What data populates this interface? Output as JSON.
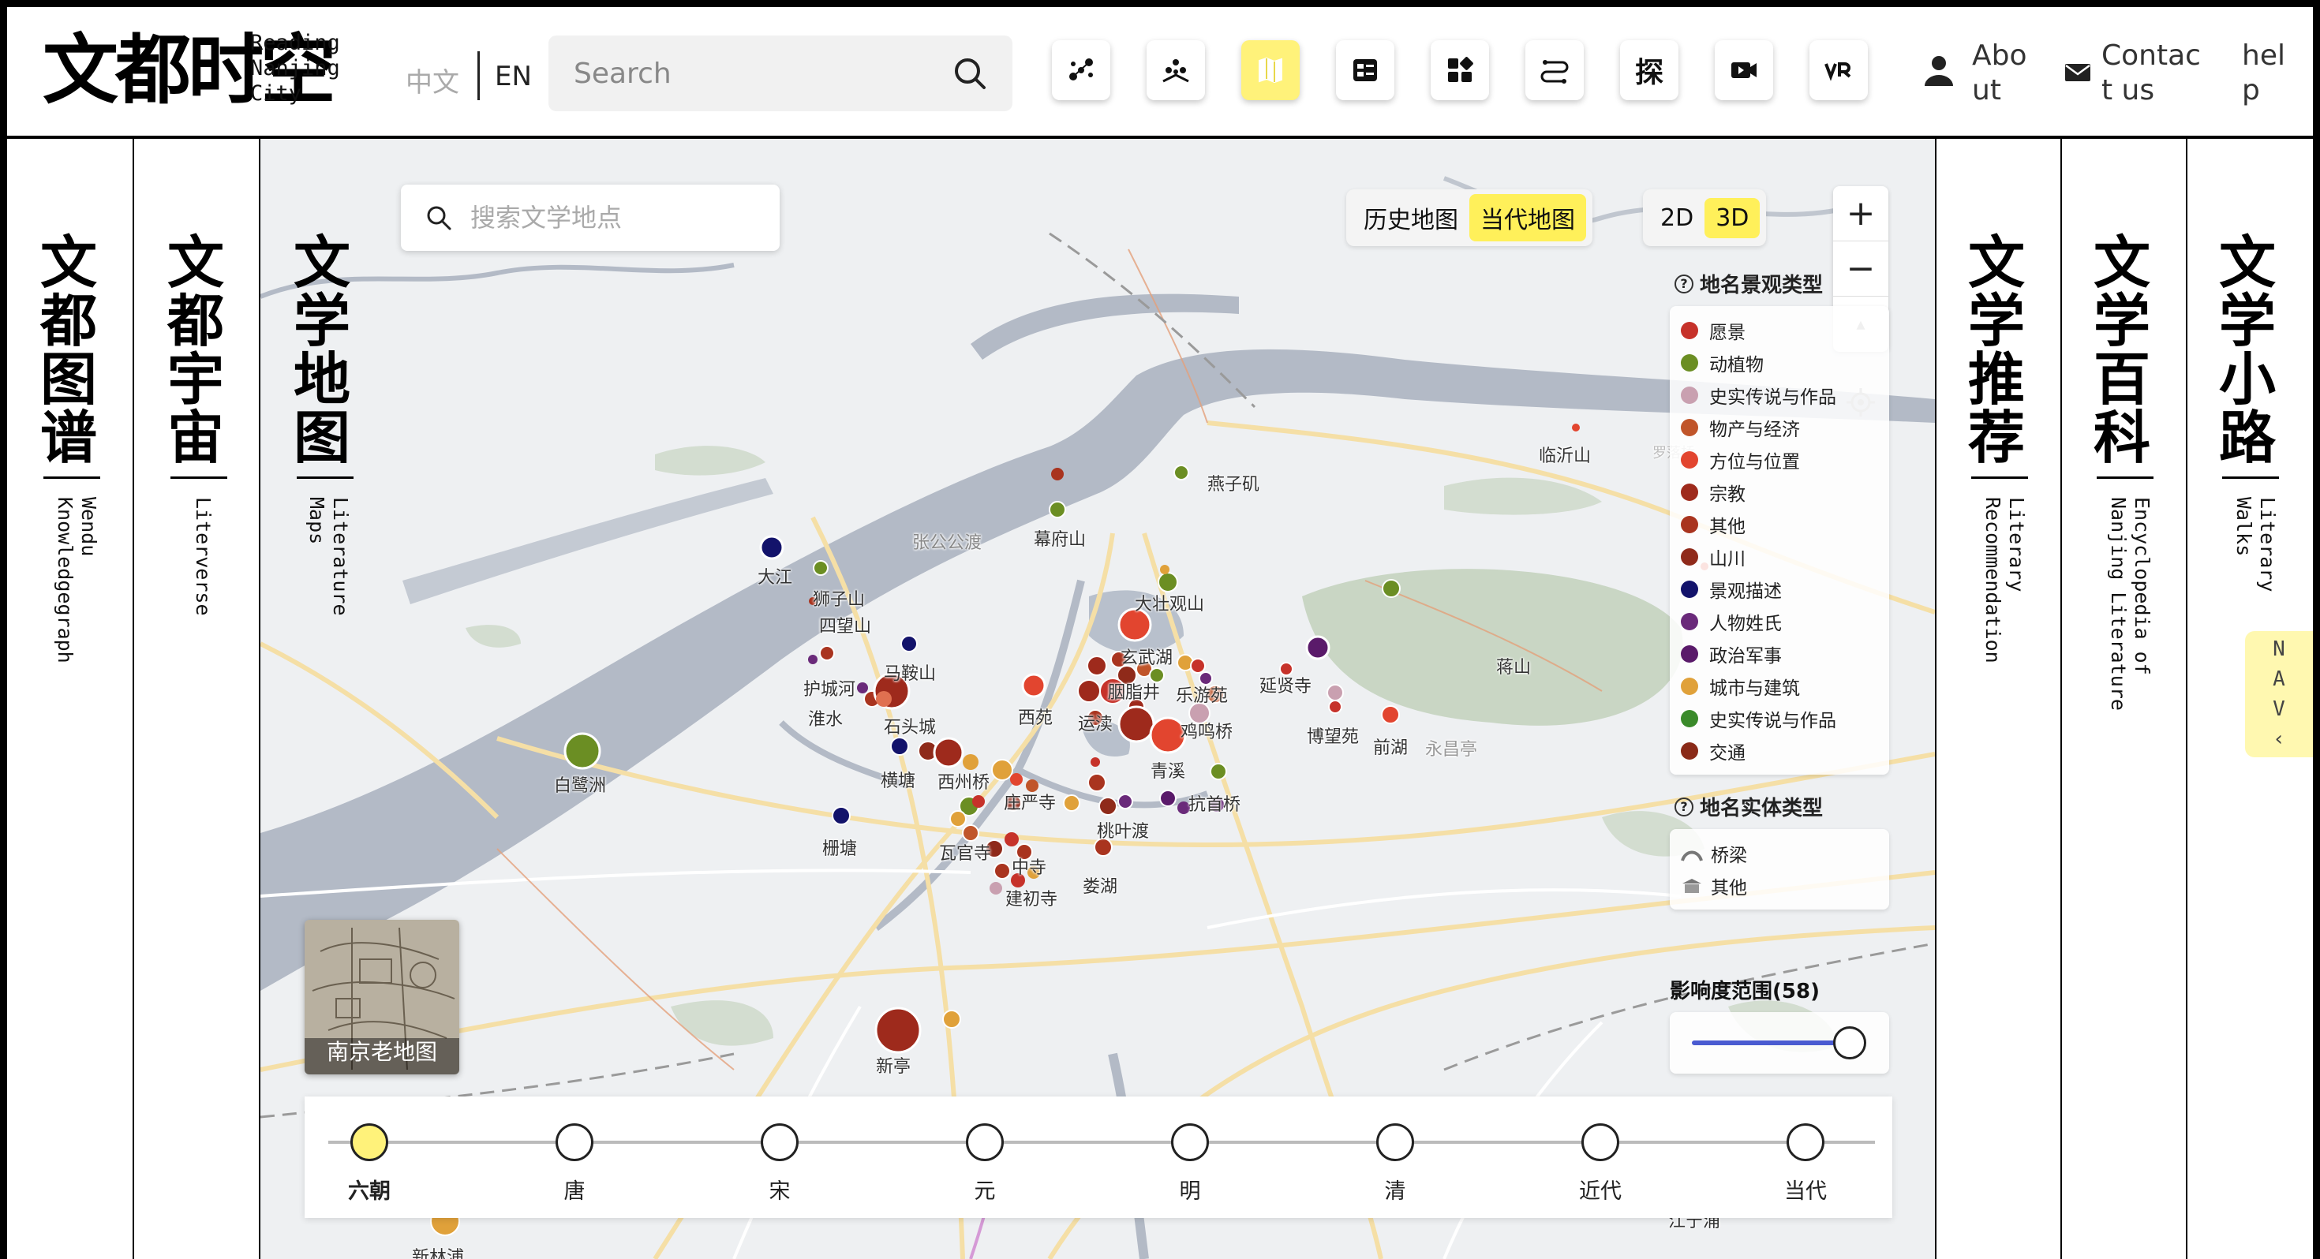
{
  "header": {
    "logo_text": "文都时空",
    "logo_sub": [
      "Reading",
      "Nanjing",
      "City"
    ],
    "lang_zh": "中文",
    "lang_en": "EN",
    "search_placeholder": "Search",
    "tools": [
      {
        "name": "network-icon",
        "label": ""
      },
      {
        "name": "cluster-icon",
        "label": ""
      },
      {
        "name": "map-icon",
        "label": "",
        "active": true
      },
      {
        "name": "list-icon",
        "label": ""
      },
      {
        "name": "grid-icon",
        "label": ""
      },
      {
        "name": "route-icon",
        "label": ""
      },
      {
        "name": "explore-icon",
        "label": "探"
      },
      {
        "name": "video-icon",
        "label": ""
      },
      {
        "name": "vr-icon",
        "label": ""
      }
    ],
    "about": "Abo\nut",
    "contact": "Contac\nt us",
    "help": "hel\np"
  },
  "side_panels": [
    {
      "title": "文都图谱",
      "subtitle": "Wendu\nKnowledgegraph"
    },
    {
      "title": "文都宇宙",
      "subtitle": "Literverse"
    },
    {
      "title": "文学地图",
      "subtitle": "Literature\nMaps"
    },
    {
      "title": "文学推荐",
      "subtitle": "Literary\nRecommendation"
    },
    {
      "title": "文学百科",
      "subtitle": "Encyclopedia of\nNanjing Literature"
    },
    {
      "title": "文学小路",
      "subtitle": "Literary\nWalks"
    }
  ],
  "nav_tab": "N\nA\nV\n‹",
  "map": {
    "search_placeholder": "搜索文学地点",
    "map_toggle": [
      "历史地图",
      "当代地图"
    ],
    "map_toggle_selected": "当代地图",
    "dim_toggle": [
      "2D",
      "3D"
    ],
    "dim_toggle_selected": "3D",
    "zoom": [
      "+",
      "−",
      "▴"
    ],
    "legend_title": "地名景观类型",
    "legend_items": [
      {
        "label": "愿景",
        "color": "#c6322a"
      },
      {
        "label": "动植物",
        "color": "#6b8e23"
      },
      {
        "label": "史实传说与作品",
        "color": "#c9a0b0"
      },
      {
        "label": "物产与经济",
        "color": "#c0552a"
      },
      {
        "label": "方位与位置",
        "color": "#e2452f"
      },
      {
        "label": "宗教",
        "color": "#9e2a1c"
      },
      {
        "label": "其他",
        "color": "#a9341f"
      },
      {
        "label": "山川",
        "color": "#8f2a1a"
      },
      {
        "label": "景观描述",
        "color": "#13136b"
      },
      {
        "label": "人物姓氏",
        "color": "#6a2a7a"
      },
      {
        "label": "政治军事",
        "color": "#5a1a6a"
      },
      {
        "label": "城市与建筑",
        "color": "#e0a13a"
      },
      {
        "label": "史实传说与作品",
        "color": "#3a8a2a"
      },
      {
        "label": "交通",
        "color": "#8a2a18"
      }
    ],
    "entity_title": "地名实体类型",
    "entity_items": [
      {
        "label": "桥梁",
        "icon": "bridge-icon"
      },
      {
        "label": "其他",
        "icon": "building-icon"
      }
    ],
    "range_title": "影响度范围(58)",
    "range_value": 58,
    "old_map_label": "南京老地图",
    "place_labels": [
      "燕子矶",
      "临沂山",
      "罗落桥",
      "张公公渡",
      "幕府山",
      "大江",
      "狮子山",
      "四望山",
      "马鞍山",
      "护城河",
      "淮水",
      "石头城",
      "西苑",
      "运渎",
      "胭脂井",
      "玄武湖",
      "大壮观山",
      "乐游苑",
      "鸡鸣桥",
      "延贤寺",
      "博望苑",
      "前湖",
      "永昌亭",
      "蒋山",
      "白鹭洲",
      "横塘",
      "西州桥",
      "庄严寺",
      "栅塘",
      "瓦官寺",
      "中寺",
      "建初寺",
      "娄湖",
      "桃叶渡",
      "青溪",
      "抗首桥",
      "新亭",
      "新林浦",
      "江宁浦"
    ]
  },
  "timeline": {
    "eras": [
      "六朝",
      "唐",
      "宋",
      "元",
      "明",
      "清",
      "近代",
      "当代"
    ],
    "selected": "六朝"
  }
}
